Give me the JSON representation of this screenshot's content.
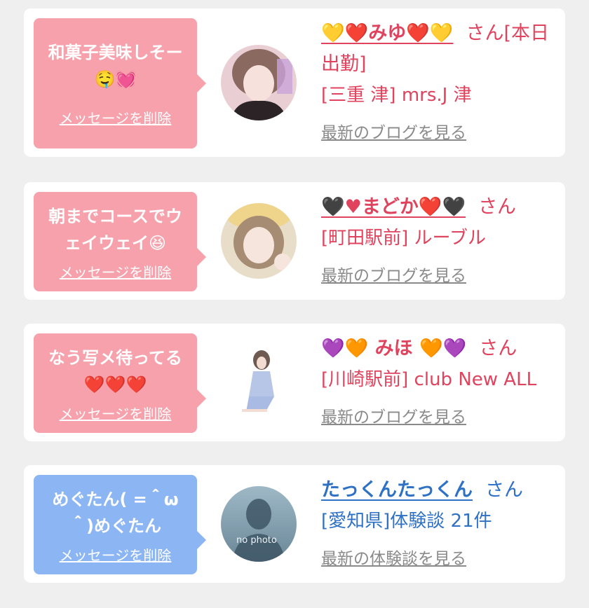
{
  "messages": [
    {
      "text": "和菓子美味しそー🤤💓",
      "delete_label": "メッセージを削除",
      "name": "💛❤️みゆ❤️💛",
      "honorific": "さん[本日出勤]",
      "shop": "[三重 津] mrs.J 津",
      "link_label": "最新のブログを見る",
      "bubble_color": "#f6a1ab",
      "name_color": "#e0435d"
    },
    {
      "text": "朝までコースでウェイウェイ😆",
      "delete_label": "メッセージを削除",
      "name": "🖤♥まどか❤️🖤",
      "honorific": "さん",
      "shop": "[町田駅前] ルーブル",
      "link_label": "最新のブログを見る",
      "bubble_color": "#f6a1ab",
      "name_color": "#e0435d"
    },
    {
      "text": "なう写メ待ってる❤️❤️❤️",
      "delete_label": "メッセージを削除",
      "name": "💜🧡 みほ 🧡💜",
      "honorific": "さん",
      "shop": "[川崎駅前] club New ALL",
      "link_label": "最新のブログを見る",
      "bubble_color": "#f6a1ab",
      "name_color": "#e0435d"
    },
    {
      "text": "めぐたん( =＾ω＾)めぐたん",
      "delete_label": "メッセージを削除",
      "name": "たっくんたっくん",
      "honorific": "さん",
      "shop": "[愛知県]体験談 21件",
      "link_label": "最新の体験談を見る",
      "avatar_label": "no photo",
      "bubble_color": "#8cb6f3",
      "name_color": "#2f71c4"
    }
  ]
}
